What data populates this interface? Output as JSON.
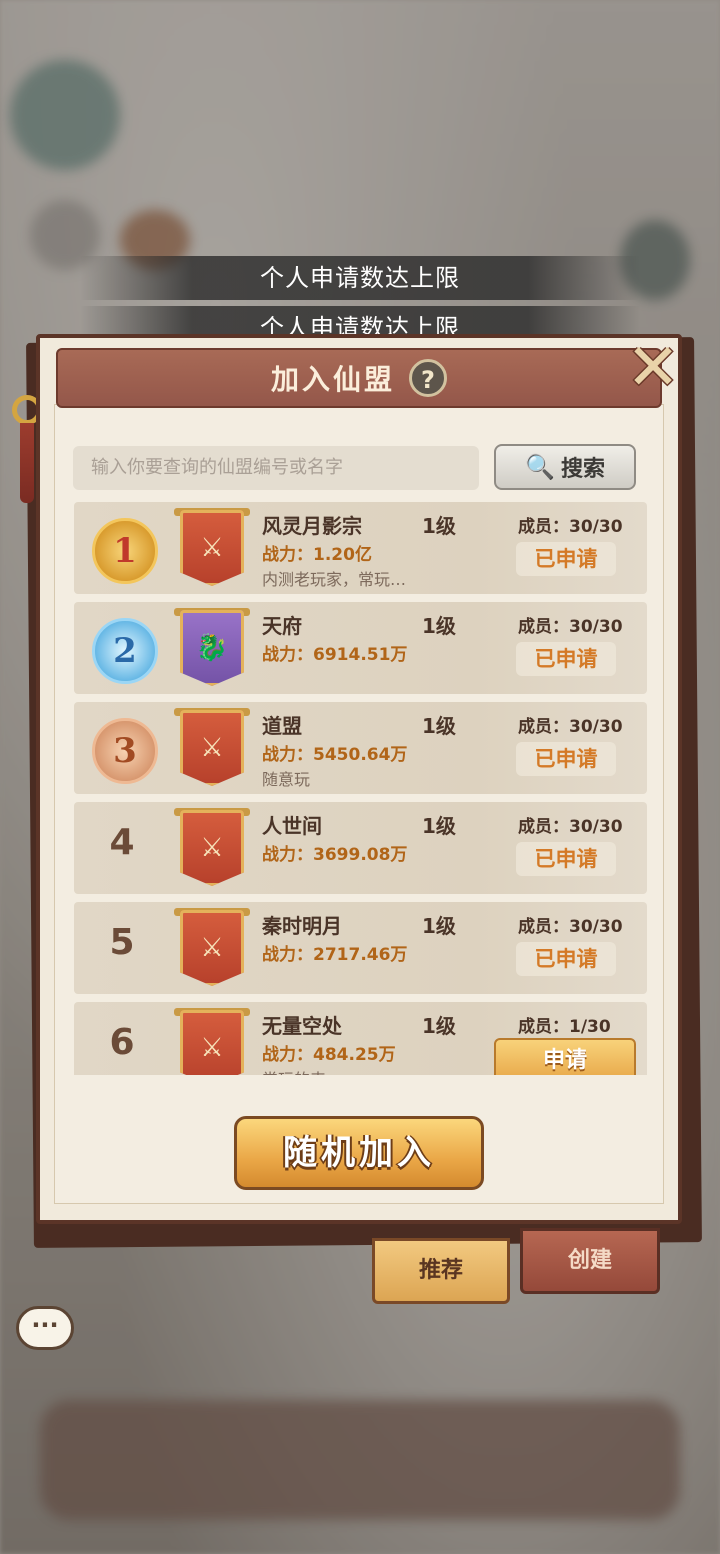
{
  "toasts": [
    "个人申请数达上限",
    "个人申请数达上限"
  ],
  "dialog": {
    "title": "加入仙盟",
    "help_icon": "?",
    "close_icon": "close-icon"
  },
  "search": {
    "placeholder": "输入你要查询的仙盟编号或名字",
    "button_label": "搜索"
  },
  "guilds": [
    {
      "rank": "1",
      "name": "风灵月影宗",
      "level": "1级",
      "power": "战力：1.20亿",
      "desc": "内测老玩家，常玩…",
      "members": "成员：30/30",
      "status": "已申请"
    },
    {
      "rank": "2",
      "name": "天府",
      "level": "1级",
      "power": "战力：6914.51万",
      "desc": "",
      "members": "成员：30/30",
      "status": "已申请"
    },
    {
      "rank": "3",
      "name": "道盟",
      "level": "1级",
      "power": "战力：5450.64万",
      "desc": "随意玩",
      "members": "成员：30/30",
      "status": "已申请"
    },
    {
      "rank": "4",
      "name": "人世间",
      "level": "1级",
      "power": "战力：3699.08万",
      "desc": "",
      "members": "成员：30/30",
      "status": "已申请"
    },
    {
      "rank": "5",
      "name": "秦时明月",
      "level": "1级",
      "power": "战力：2717.46万",
      "desc": "",
      "members": "成员：30/30",
      "status": "已申请"
    },
    {
      "rank": "6",
      "name": "无量空处",
      "level": "1级",
      "power": "战力：484.25万",
      "desc": "常玩的来",
      "members": "成员：1/30",
      "status": "申请"
    }
  ],
  "random_join_label": "随机加入",
  "tabs": {
    "recommend": "推荐",
    "create": "创建"
  },
  "chat_icon": "···"
}
